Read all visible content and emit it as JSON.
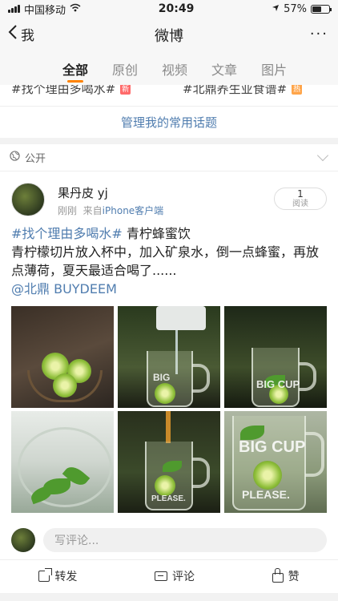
{
  "status_bar": {
    "carrier": "中国移动",
    "time": "20:49",
    "battery": "57%",
    "battery_level": 0.57
  },
  "nav": {
    "back_label": "我",
    "title": "微博",
    "more": "···"
  },
  "tabs": [
    {
      "label": "全部",
      "active": true
    },
    {
      "label": "原创",
      "active": false
    },
    {
      "label": "视频",
      "active": false
    },
    {
      "label": "文章",
      "active": false
    },
    {
      "label": "图片",
      "active": false
    }
  ],
  "topics": [
    {
      "label": "#找个理由多喝水#",
      "badge": "新",
      "badge_color": "#ff6a6a"
    },
    {
      "label": "#北鼎养生业食谱#",
      "badge": "热",
      "badge_color": "#ffa54a"
    }
  ],
  "manage_topics": "管理我的常用话题",
  "post": {
    "visibility": "公开",
    "author": "果丹皮 yj",
    "time": "刚刚",
    "source_prefix": "来自",
    "source": "iPhone客户端",
    "read_count": "1",
    "read_label": "阅读",
    "topic": "#找个理由多喝水#",
    "title": " 青柠蜂蜜饮",
    "body": "青柠檬切片放入杯中，加入矿泉水，倒一点蜂蜜，再放点薄荷，夏天最适合喝了......",
    "mention": "@北鼎 BUYDEEM",
    "images": [
      "photo-limes-bowl",
      "photo-pouring-water",
      "photo-glass-mint",
      "photo-mint-closeup",
      "photo-honey-drizzle",
      "photo-big-cup"
    ]
  },
  "comment": {
    "placeholder": "写评论..."
  },
  "actions": {
    "share": "转发",
    "comment": "评论",
    "like": "赞"
  },
  "colors": {
    "accent": "#ff8200",
    "link": "#507daf"
  }
}
